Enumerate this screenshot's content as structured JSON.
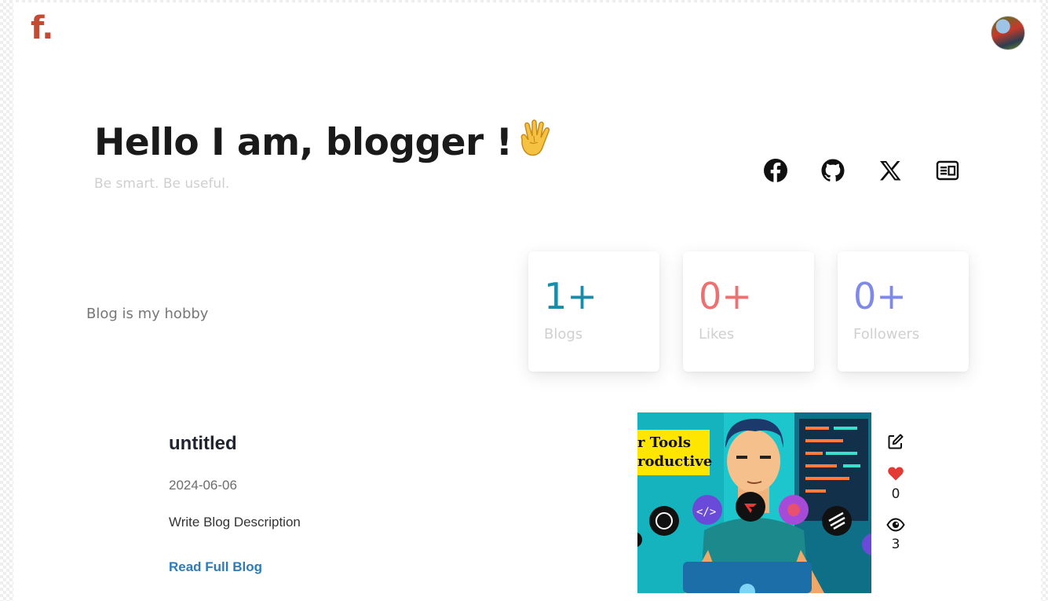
{
  "header": {
    "logo": "f.",
    "avatar_icon": "user-avatar"
  },
  "hero": {
    "title": "Hello I am, blogger !",
    "emoji_icon": "vulcan-salute-hand",
    "tagline": "Be smart. Be useful."
  },
  "socials": [
    {
      "icon": "facebook-icon"
    },
    {
      "icon": "github-icon"
    },
    {
      "icon": "x-twitter-icon"
    },
    {
      "icon": "newspaper-icon"
    }
  ],
  "hobby": "Blog is my hobby",
  "stats": [
    {
      "value": "1+",
      "label": "Blogs",
      "color": "#1a8ca8"
    },
    {
      "value": "0+",
      "label": "Likes",
      "color": "#ee7070"
    },
    {
      "value": "0+",
      "label": "Followers",
      "color": "#7f8ae8"
    }
  ],
  "post": {
    "title": "untitled",
    "date": "2024-06-06",
    "description": "Write Blog Description",
    "read_more": "Read Full Blog",
    "thumbnail_text_1": "r Tools",
    "thumbnail_text_2": "roductive",
    "likes": "0",
    "views": "3"
  },
  "colors": {
    "logo": "#c44b32",
    "link": "#2f7ab8",
    "heart": "#e53935"
  }
}
